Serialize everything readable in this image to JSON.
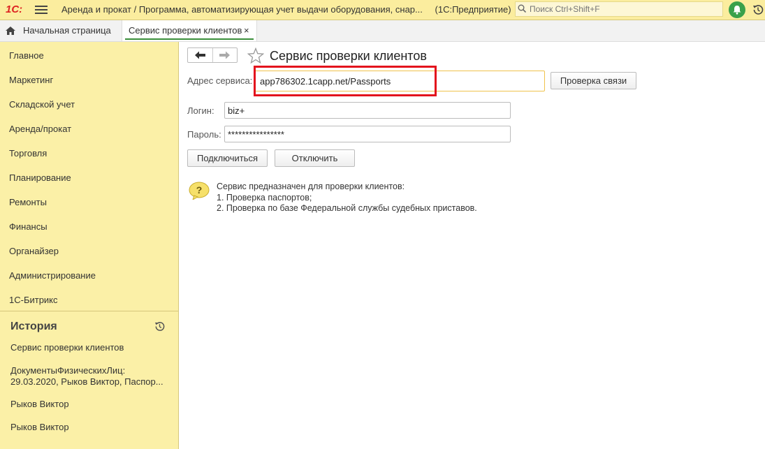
{
  "app": {
    "logo": "1С:",
    "title": "Аренда и прокат / Программа, автоматизирующая учет выдачи оборудования, снар...",
    "platform": "(1С:Предприятие)",
    "search_placeholder": "Поиск Ctrl+Shift+F"
  },
  "tabs": {
    "home": "Начальная страница",
    "active": "Сервис проверки клиентов",
    "close_glyph": "×"
  },
  "sidebar": {
    "items": [
      "Главное",
      "Маркетинг",
      "Складской учет",
      "Аренда/прокат",
      "Торговля",
      "Планирование",
      "Ремонты",
      "Финансы",
      "Органайзер",
      "Администрирование",
      "1С-Битрикс"
    ],
    "history_title": "История",
    "history": [
      "Сервис проверки клиентов",
      "ДокументыФизическихЛиц:",
      "29.03.2020, Рыков Виктор, Паспор...",
      "Рыков Виктор",
      "Рыков Виктор"
    ]
  },
  "form": {
    "title": "Сервис проверки клиентов",
    "address_label": "Адрес сервиса:",
    "address_value": "app786302.1capp.net/Passports",
    "check_button": "Проверка связи",
    "login_label": "Логин:",
    "login_value": "biz+",
    "password_label": "Пароль:",
    "password_value": "****************",
    "connect_button": "Подключиться",
    "disconnect_button": "Отключить",
    "info_lines": [
      "Сервис предназначен для проверки клиентов:",
      "1. Проверка паспортов;",
      "2. Проверка по базе Федеральной службы судебных приставов."
    ]
  },
  "colors": {
    "panel_yellow": "#fbf0a7",
    "highlight_red": "#e3121d",
    "accent_green": "#3aa14a"
  }
}
